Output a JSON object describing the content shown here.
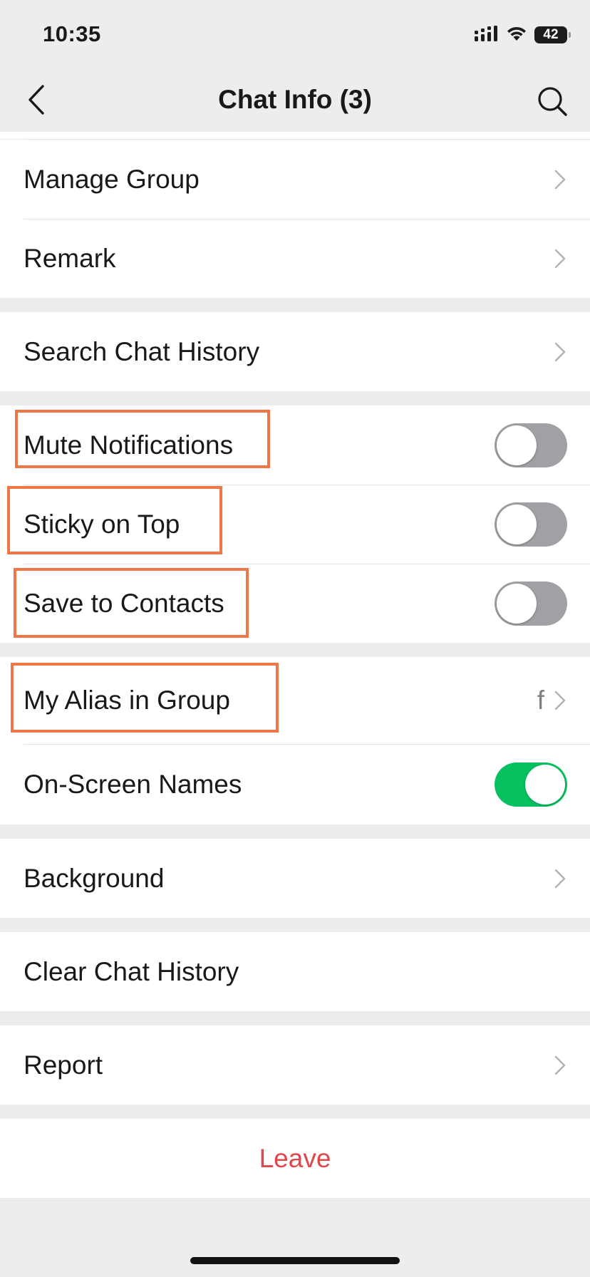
{
  "status_bar": {
    "time": "10:35",
    "battery": "42",
    "icons": [
      "signal-icon",
      "wifi-icon",
      "battery-icon"
    ]
  },
  "nav": {
    "title": "Chat Info (3)",
    "back_icon": "chevron-left-icon",
    "search_icon": "search-icon"
  },
  "colors": {
    "accent_green": "#07c160",
    "leave_red": "#e0474c",
    "highlight_orange": "#f07648",
    "background": "#ededed"
  },
  "sections": {
    "manage": {
      "manage_group": "Manage Group",
      "remark": "Remark"
    },
    "search": {
      "search_chat_history": "Search Chat History"
    },
    "settings": {
      "mute_notifications": {
        "label": "Mute Notifications",
        "on": false
      },
      "sticky_on_top": {
        "label": "Sticky on Top",
        "on": false
      },
      "save_to_contacts": {
        "label": "Save to Contacts",
        "on": false
      }
    },
    "names": {
      "my_alias": {
        "label": "My Alias in Group",
        "value": "f"
      },
      "on_screen_names": {
        "label": "On-Screen Names",
        "on": true
      }
    },
    "background": {
      "label": "Background"
    },
    "clear": {
      "label": "Clear Chat History"
    },
    "report": {
      "label": "Report"
    },
    "leave": {
      "label": "Leave"
    }
  }
}
